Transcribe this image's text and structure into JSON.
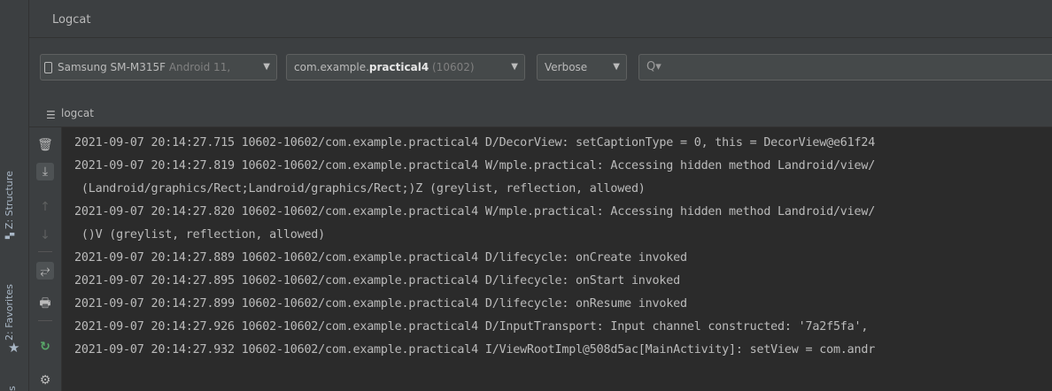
{
  "side": {
    "structure_label": "Z: Structure",
    "favorites_label": "2: Favorites",
    "bottom_letter": "s"
  },
  "panel": {
    "title": "Logcat"
  },
  "toolbar": {
    "device": {
      "name": "Samsung SM-M315F",
      "os": "Android 11,"
    },
    "process": {
      "prefix": "com.example.",
      "app": "practical4",
      "pid": "(10602)"
    },
    "level": "Verbose",
    "search": {
      "placeholder": "",
      "icon": "search-icon"
    }
  },
  "subheader": {
    "label": "logcat"
  },
  "log_lines": [
    "2021-09-07 20:14:27.715 10602-10602/com.example.practical4 D/DecorView: setCaptionType = 0, this = DecorView@e61f24",
    "2021-09-07 20:14:27.819 10602-10602/com.example.practical4 W/mple.practical: Accessing hidden method Landroid/view/",
    " (Landroid/graphics/Rect;Landroid/graphics/Rect;)Z (greylist, reflection, allowed)",
    "2021-09-07 20:14:27.820 10602-10602/com.example.practical4 W/mple.practical: Accessing hidden method Landroid/view/",
    " ()V (greylist, reflection, allowed)",
    "2021-09-07 20:14:27.889 10602-10602/com.example.practical4 D/lifecycle: onCreate invoked",
    "2021-09-07 20:14:27.895 10602-10602/com.example.practical4 D/lifecycle: onStart invoked",
    "2021-09-07 20:14:27.899 10602-10602/com.example.practical4 D/lifecycle: onResume invoked",
    "2021-09-07 20:14:27.926 10602-10602/com.example.practical4 D/InputTransport: Input channel constructed: '7a2f5fa',",
    "2021-09-07 20:14:27.932 10602-10602/com.example.practical4 I/ViewRootImpl@508d5ac[MainActivity]: setView = com.andr"
  ]
}
